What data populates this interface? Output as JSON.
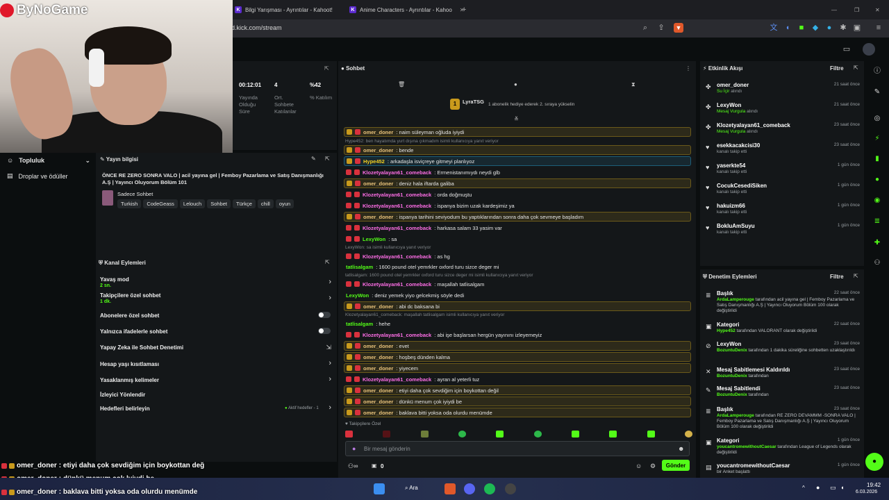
{
  "browser": {
    "tabs": [
      {
        "label": "Bilgi Yarışması - Ayrıntılar - Kahoot!"
      },
      {
        "label": "Anime Characters - Ayrıntılar - Kahoo"
      }
    ],
    "url": "d.kick.com/stream"
  },
  "overlay": {
    "logo_text": "ByNoGame",
    "chat_lines": [
      {
        "user": "omer_doner",
        "text": ": etiyi daha çok sevdiğim için boykottan değ"
      },
      {
        "user": "omer_doner",
        "text": ": dünkü menum çok lyiydi be"
      },
      {
        "user": "omer_doner",
        "text": ": baklava bitti yoksa oda olurdu menümde"
      }
    ]
  },
  "left_nav": {
    "community": "Topluluk",
    "drops": "Droplar ve ödüller"
  },
  "stats": {
    "items": [
      {
        "value": "00:12:01",
        "label": "Yayında Olduğu Süre"
      },
      {
        "value": "4",
        "label": "Ort. Sohbete Katılanlar"
      },
      {
        "value": "%42",
        "label": "% Katılım"
      }
    ]
  },
  "stream_info": {
    "header": "Yayın bilgisi",
    "title": "ÖNCE RE ZERO SONRA VALO | acil yayına gel | Femboy Pazarlama ve Satış Danışmanlığı A.Ş | Yayıncı Oluyorum Bölüm 101",
    "category": "Sadece Sohbet",
    "tags": [
      "Turkish",
      "CodeGeass",
      "Lelouch",
      "Sohbet",
      "Türkçe",
      "chill",
      "oyun"
    ]
  },
  "channel_actions": {
    "header": "Kanal Eylemleri",
    "items": [
      {
        "label": "Yavaş mod",
        "sub": "2 sn."
      },
      {
        "label": "Takipçilere özel sohbet",
        "sub": "1 dk."
      },
      {
        "label": "Abonelere özel sohbet",
        "sub": ""
      },
      {
        "label": "Yalnızca ifadelerle sohbet",
        "sub": ""
      },
      {
        "label": "Yapay Zeka ile Sohbet Denetimi",
        "sub": ""
      },
      {
        "label": "Hesap yaşı kısıtlaması",
        "sub": ""
      },
      {
        "label": "Yasaklanmış kelimeler",
        "sub": ""
      },
      {
        "label": "İzleyici Yönlendir",
        "sub": ""
      },
      {
        "label": "Hedefleri belirleyin",
        "sub": ""
      }
    ],
    "goals_status": "Aktif hedefler - 1"
  },
  "chat": {
    "header": "Sohbet",
    "pinned_user": "LyraTSG",
    "pinned_rank": "1",
    "pinned_text": "1 abonelik hediye ederek 2. sıraya yükselin",
    "messages": [
      {
        "type": "msg",
        "user": "omer_doner",
        "text": ": naim süleyman oğluda iyiydi",
        "color": "#e8c27a",
        "style": "hl"
      },
      {
        "type": "reply",
        "text": "Hype452: ben hayatımda yurt dışına çıkmadım isimli kullanıcıya yanıt veriyor"
      },
      {
        "type": "msg",
        "user": "omer_doner",
        "text": ": bende",
        "color": "#e8c27a",
        "style": "hl"
      },
      {
        "type": "msg",
        "user": "Hype452",
        "text": ": arkadaşla isviçreye gitmeyi planlıyoz",
        "color": "#f5d020",
        "style": "hlb"
      },
      {
        "type": "msg",
        "user": "Klozetyalayan61_comeback",
        "text": ": Ermenistanımıydı neydi glb",
        "color": "#ff6ee7",
        "style": ""
      },
      {
        "type": "msg",
        "user": "omer_doner",
        "text": ": deniz hala iftarda galiba",
        "color": "#e8c27a",
        "style": "hl"
      },
      {
        "type": "msg",
        "user": "Klozetyalayan61_comeback",
        "text": ": orda doğmuştu",
        "color": "#ff6ee7",
        "style": ""
      },
      {
        "type": "msg",
        "user": "Klozetyalayan61_comeback",
        "text": ": ispanya bizim uzak kardeşimiz ya",
        "color": "#ff6ee7",
        "style": ""
      },
      {
        "type": "msg",
        "user": "omer_doner",
        "text": ": ispanya tarihini seviyodum bu yaptıklarından sonra daha çok sevmeye başladım",
        "color": "#e8c27a",
        "style": "hl"
      },
      {
        "type": "msg",
        "user": "Klozetyalayan61_comeback",
        "text": ": harkasa salam 33 yasim var",
        "color": "#ff6ee7",
        "style": ""
      },
      {
        "type": "msg",
        "user": "LexyWon",
        "text": ": sa",
        "color": "#53fc18",
        "style": ""
      },
      {
        "type": "reply",
        "text": "LexyWon: sa isimli kullanıcıya yanıt veriyor"
      },
      {
        "type": "msg",
        "user": "Klozetyalayan61_comeback",
        "text": ": as hg",
        "color": "#ff6ee7",
        "style": ""
      },
      {
        "type": "msg",
        "user": "tatlisalgam",
        "text": ": 1600 pound otel yemrkler oxford turu sizce deger mi",
        "color": "#53fc18",
        "style": "plain"
      },
      {
        "type": "reply",
        "text": "tatlisalgam: 1600 pound otel yemrkler oxford turu sizce deger mi isimli kullanıcıya yanıt veriyor"
      },
      {
        "type": "msg",
        "user": "Klozetyalayan61_comeback",
        "text": ": maşallah tatlisalgam",
        "color": "#ff6ee7",
        "style": ""
      },
      {
        "type": "msg",
        "user": "LexyWon",
        "text": ": deniz yemek yiyo gelcekmiş söyle dedi",
        "color": "#53fc18",
        "style": "plain"
      },
      {
        "type": "msg",
        "user": "omer_doner",
        "text": ": abi dc baksana bi",
        "color": "#e8c27a",
        "style": "hl"
      },
      {
        "type": "reply",
        "text": "Klozetyalayan61_comeback: maşallah tatlisalgam isimli kullanıcıya yanıt veriyor"
      },
      {
        "type": "msg",
        "user": "tatlisalgam",
        "text": ": hehe",
        "color": "#53fc18",
        "style": "plain"
      },
      {
        "type": "msg",
        "user": "Klozetyalayan61_comeback",
        "text": ": abi işe başlarsan hergün yayınını izleyemeyiz",
        "color": "#ff6ee7",
        "style": ""
      },
      {
        "type": "msg",
        "user": "omer_doner",
        "text": ": evet",
        "color": "#e8c27a",
        "style": "hl"
      },
      {
        "type": "msg",
        "user": "omer_doner",
        "text": ": hoşbeş dünden kalma",
        "color": "#e8c27a",
        "style": "hl"
      },
      {
        "type": "msg",
        "user": "omer_doner",
        "text": ": yiyecem",
        "color": "#e8c27a",
        "style": "hl"
      },
      {
        "type": "msg",
        "user": "Klozetyalayan61_comeback",
        "text": ": ayran al yeterli tuz",
        "color": "#ff6ee7",
        "style": ""
      },
      {
        "type": "msg",
        "user": "omer_doner",
        "text": ": etiyi daha çok sevdiğim için boykottan değil",
        "color": "#e8c27a",
        "style": "hl"
      },
      {
        "type": "msg",
        "user": "omer_doner",
        "text": ": dünkü menum çok iyiydi be",
        "color": "#e8c27a",
        "style": "hl"
      },
      {
        "type": "msg",
        "user": "omer_doner",
        "text": ": baklava bitti yoksa oda olurdu menümde",
        "color": "#e8c27a",
        "style": "hl"
      }
    ],
    "follower_only_label": "Takipçilere Özel",
    "input_placeholder": "Bir mesaj gönderin",
    "points": "0",
    "send_label": "Gönder"
  },
  "activity": {
    "header": "Etkinlik Akışı",
    "filter": "Filtre",
    "events": [
      {
        "user": "omer_doner",
        "desc": "Su İçir",
        "desc2": " alındı",
        "time": "21 saat önce"
      },
      {
        "user": "LexyWon",
        "desc": "Mesaj Vurgula",
        "desc2": " alındı",
        "time": "21 saat önce"
      },
      {
        "user": "Klozetyalayan61_comeback",
        "desc": "Mesaj Vurgula",
        "desc2": " alındı",
        "time": "23 saat önce"
      },
      {
        "user": "esekkacakcisi30",
        "desc": "",
        "desc2": "kanalı takip etti",
        "time": "23 saat önce"
      },
      {
        "user": "yaserkte54",
        "desc": "",
        "desc2": "kanalı takip etti",
        "time": "1 gün önce"
      },
      {
        "user": "CocukCesediSiken",
        "desc": "",
        "desc2": "kanalı takip etti",
        "time": "1 gün önce"
      },
      {
        "user": "hakuizm66",
        "desc": "",
        "desc2": "kanalı takip etti",
        "time": "1 gün önce"
      },
      {
        "user": "BokluAmSuyu",
        "desc": "",
        "desc2": "kanalı takip etti",
        "time": "1 gün önce"
      }
    ]
  },
  "moderation": {
    "header": "Denetim Eylemleri",
    "filter": "Filtre",
    "items": [
      {
        "title": "Başlık",
        "time": "22 saat önce",
        "actor": "ArdaLamperouge",
        "desc": " tarafından acil yayına gel | Femboy Pazarlama ve Satış Danışmanlığı A.Ş | Yayıncı Oluyorum Bölüm 100 olarak değiştirildi"
      },
      {
        "title": "Kategori",
        "time": "22 saat önce",
        "actor": "Hype452",
        "desc": " tarafından VALORANT olarak değiştirildi"
      },
      {
        "title": "LexyWon",
        "time": "23 saat önce",
        "actor": "BozuntuDenix",
        "desc": " tarafından 1 dakika süreliğine sohbetten uzaklaştırıldı"
      },
      {
        "title": "Mesaj Sabitlemesi Kaldırıldı",
        "time": "23 saat önce",
        "actor": "BozuntuDenix",
        "desc": " tarafından"
      },
      {
        "title": "Mesaj Sabitlendi",
        "time": "23 saat önce",
        "actor": "BozuntuDenix",
        "desc": " tarafından"
      },
      {
        "title": "Başlık",
        "time": "23 saat önce",
        "actor": "ArdaLamperouge",
        "desc": " tarafından RE ZERO DEVAMMM -SONRA VALO | Femboy Pazarlama ve Satış Danışmanlığı A.Ş | Yayıncı Oluyorum Bölüm 100 olarak değiştirildi"
      },
      {
        "title": "Kategori",
        "time": "1 gün önce",
        "actor": "youcantromewithoutCaesar",
        "desc": " tarafından League of Legends olarak değiştirildi"
      },
      {
        "title": "youcantromewithoutCaesar",
        "time": "1 gün önce",
        "actor": "",
        "desc": " bir Anket başlattı"
      }
    ]
  },
  "taskbar": {
    "search_label": "Ara",
    "time": "19:42",
    "date": "6.03.2026"
  }
}
